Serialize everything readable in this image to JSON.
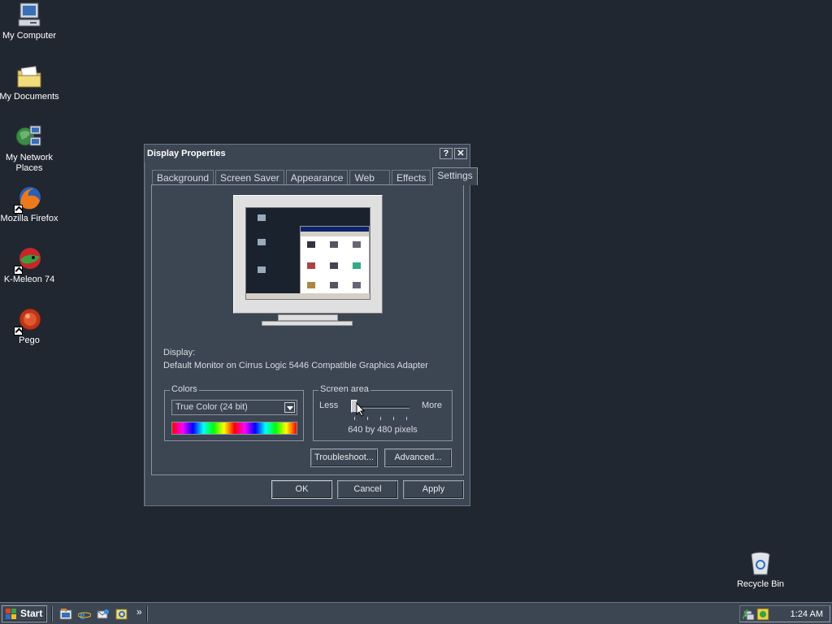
{
  "desktop": {
    "icons": [
      {
        "label": "My Computer",
        "icon": "computer-icon"
      },
      {
        "label": "My Documents",
        "icon": "folder-icon"
      },
      {
        "label": "My Network Places",
        "icon": "network-icon"
      },
      {
        "label": "Mozilla Firefox",
        "icon": "firefox-icon"
      },
      {
        "label": "K-Meleon 74",
        "icon": "kmeleon-icon"
      },
      {
        "label": "Pego",
        "icon": "pego-icon"
      },
      {
        "label": "Recycle Bin",
        "icon": "recycle-bin-icon"
      }
    ]
  },
  "dialog": {
    "title": "Display Properties",
    "help_button": "?",
    "close_button": "✕",
    "tabs": [
      "Background",
      "Screen Saver",
      "Appearance",
      "Web",
      "Effects",
      "Settings"
    ],
    "active_tab": "Settings",
    "display_label": "Display:",
    "display_value": "Default Monitor on Cirrus Logic 5446 Compatible Graphics Adapter",
    "colors": {
      "legend": "Colors",
      "selected": "True Color (24 bit)"
    },
    "screen_area": {
      "legend": "Screen area",
      "less": "Less",
      "more": "More",
      "resolution": "640 by 480 pixels",
      "slider_position": 0
    },
    "buttons": {
      "troubleshoot": "Troubleshoot...",
      "advanced": "Advanced...",
      "ok": "OK",
      "cancel": "Cancel",
      "apply": "Apply"
    }
  },
  "taskbar": {
    "start_label": "Start",
    "chevron": "»",
    "clock": "1:24 AM"
  }
}
